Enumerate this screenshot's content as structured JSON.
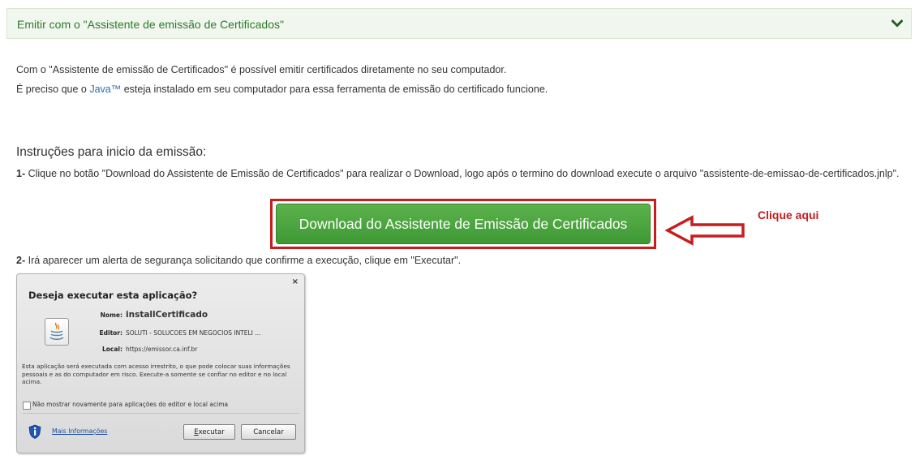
{
  "accordion": {
    "title": "Emitir com o \"Assistente de emissão de Certificados\""
  },
  "intro": {
    "line1": "Com o \"Assistente de emissão de Certificados\" é possível emitir certificados diretamente no seu computador.",
    "line2_prefix": "É preciso que o ",
    "line2_link": "Java™",
    "line2_suffix": " esteja instalado em seu computador para essa ferramenta de emissão do certificado funcione."
  },
  "instructions": {
    "title": "Instruções para inicio da emissão:",
    "step1_num": "1-",
    "step1_text": " Clique no botão \"Download do Assistente de Emissão de Certificados\" para realizar o Download, logo após o termino do download execute o arquivo \"assistente-de-emissao-de-certificados.jnlp\".",
    "download_button": "Download do Assistente de Emissão de Certificados",
    "callout": "Clique aqui",
    "step2_num": "2-",
    "step2_text": " Irá aparecer um alerta de segurança solicitando que confirme a execução, clique em \"Executar\"."
  },
  "dialog": {
    "close": "×",
    "title": "Deseja executar esta aplicação?",
    "name_label": "Nome:",
    "name_value": "installCertificado",
    "editor_label": "Editor:",
    "editor_value": "SOLUTI - SOLUCOES EM NEGOCIOS INTELI ...",
    "local_label": "Local:",
    "local_value": "https://emissor.ca.inf.br",
    "warning": "Esta aplicação será executada com acesso irrestrito, o que pode colocar suas informações pessoais e as do computador em risco. Execute-a somente se confiar no editor e no local acima.",
    "checkbox_label": "Não mostrar novamente para aplicações do editor e local acima",
    "more_info": "Mais Informações",
    "run_first": "E",
    "run_rest": "xecutar",
    "cancel": "Cancelar"
  },
  "colors": {
    "accent_green": "#3e9934",
    "highlight_red": "#c71d1d",
    "header_green_text": "#2d7a2d"
  }
}
